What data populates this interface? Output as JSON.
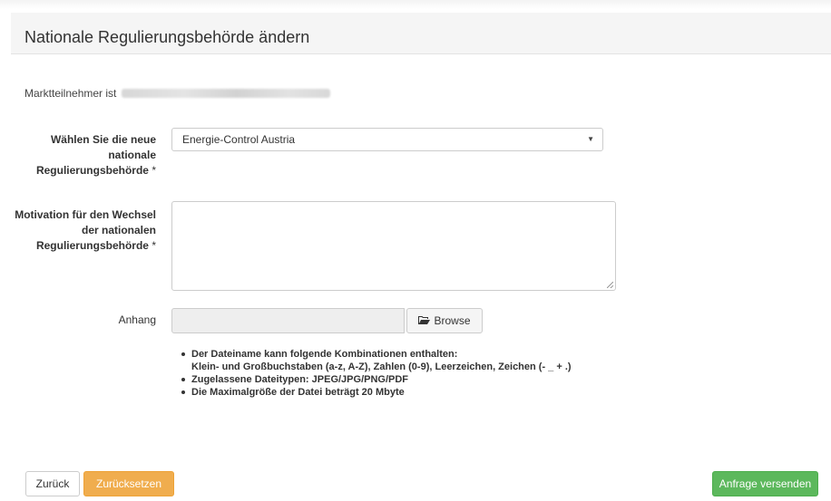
{
  "panel": {
    "title": "Nationale Regulierungsbehörde ändern"
  },
  "participant": {
    "prefix": "Marktteilnehmer ist"
  },
  "form": {
    "regulator": {
      "label": "Wählen Sie die neue nationale Regulierungsbehörde",
      "required_mark": "*",
      "selected_value": "Energie-Control Austria"
    },
    "motivation": {
      "label": "Motivation für den Wechsel der nationalen Regulierungsbehörde",
      "required_mark": "*",
      "value": ""
    },
    "attachment": {
      "label": "Anhang",
      "value": "",
      "browse_label": "Browse"
    },
    "rules": [
      {
        "text": "Der Dateiname kann folgende Kombinationen enthalten:",
        "sub": "Klein- und Großbuchstaben (a-z, A-Z), Zahlen (0-9), Leerzeichen, Zeichen (- _ + .)"
      },
      {
        "text": "Zugelassene Dateitypen: JPEG/JPG/PNG/PDF"
      },
      {
        "text": "Die Maximalgröße der Datei beträgt 20 Mbyte"
      }
    ]
  },
  "actions": {
    "back_label": "Zurück",
    "reset_label": "Zurücksetzen",
    "send_label": "Anfrage versenden"
  },
  "colors": {
    "reset_button": "#f0ad4e",
    "send_button": "#5cb85c",
    "header_background": "#f5f5f5"
  },
  "icons": {
    "select_caret": "caret-down-icon",
    "browse": "folder-open-icon"
  }
}
